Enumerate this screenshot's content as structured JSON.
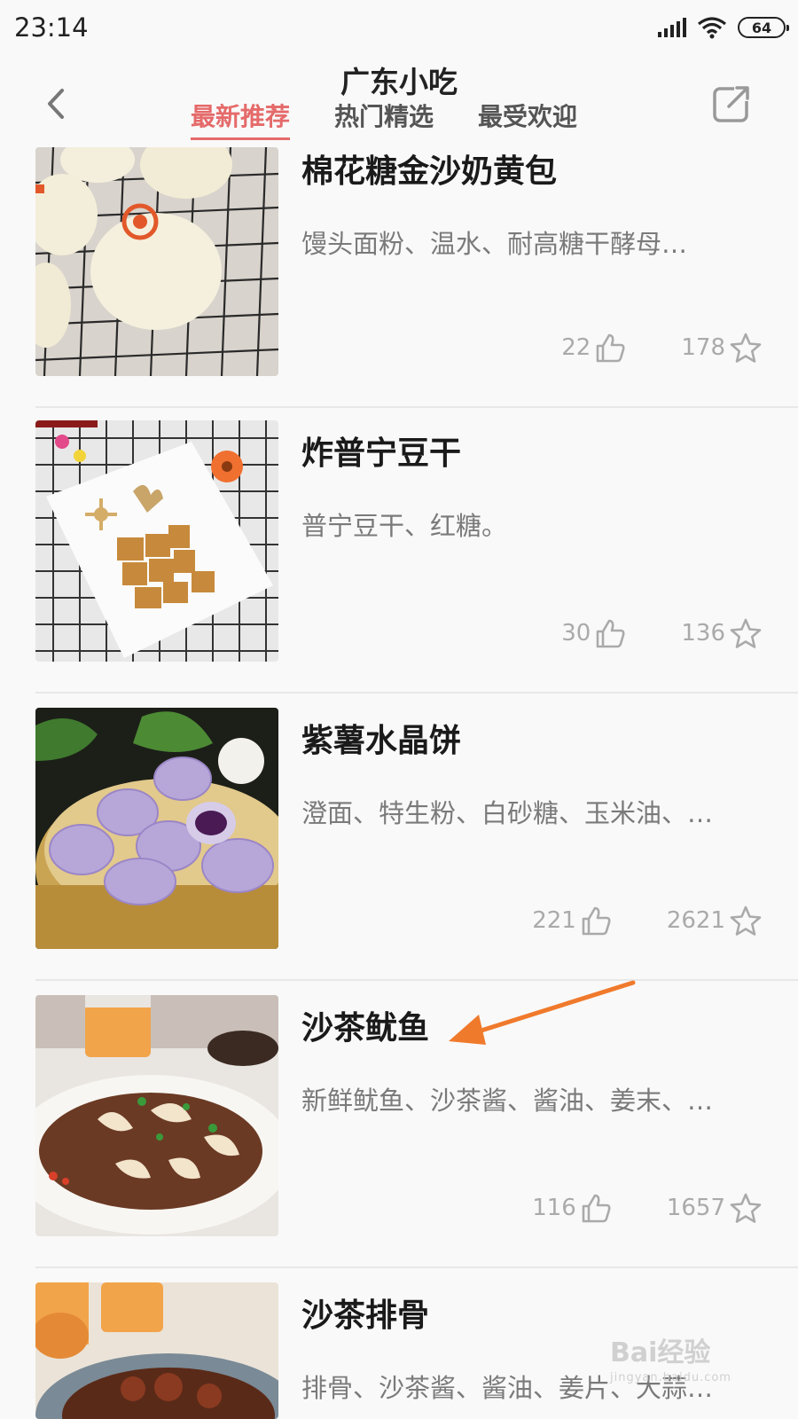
{
  "status_bar": {
    "time": "23:14",
    "battery": "64"
  },
  "header": {
    "title": "广东小吃",
    "tabs": [
      {
        "label": "最新推荐",
        "active": true
      },
      {
        "label": "热门精选",
        "active": false
      },
      {
        "label": "最受欢迎",
        "active": false
      }
    ]
  },
  "recipes": [
    {
      "title": "棉花糖金沙奶黄包",
      "ingredients": "馒头面粉、温水、耐高糖干酵母…",
      "likes": "22",
      "favorites": "178",
      "image": "steamed-buns"
    },
    {
      "title": "炸普宁豆干",
      "ingredients": "普宁豆干、红糖。",
      "likes": "30",
      "favorites": "136",
      "image": "fried-tofu"
    },
    {
      "title": "紫薯水晶饼",
      "ingredients": "澄面、特生粉、白砂糖、玉米油、…",
      "likes": "221",
      "favorites": "2621",
      "image": "purple-crystal-cakes"
    },
    {
      "title": "沙茶鱿鱼",
      "ingredients": "新鲜鱿鱼、沙茶酱、酱油、姜末、…",
      "likes": "116",
      "favorites": "1657",
      "image": "satay-squid"
    },
    {
      "title": "沙茶排骨",
      "ingredients": "排骨、沙茶酱、酱油、姜片、大蒜…",
      "likes": "",
      "favorites": "",
      "image": "satay-ribs"
    }
  ],
  "icons": {
    "back": "chevron-left-icon",
    "share": "share-icon",
    "like": "thumbs-up-icon",
    "favorite": "star-icon"
  },
  "colors": {
    "accent": "#e56a6a",
    "arrow": "#f07a2c",
    "meta": "#aaaaaa"
  },
  "watermark": {
    "text": "Bai经验",
    "sub": "jingyan.baidu.com"
  }
}
